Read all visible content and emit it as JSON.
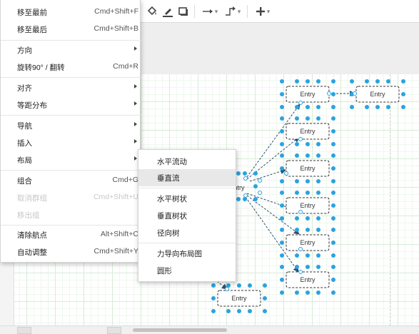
{
  "context_menu": {
    "items": [
      {
        "label": "移至最前",
        "shortcut": "Cmd+Shift+F"
      },
      {
        "label": "移至最后",
        "shortcut": "Cmd+Shift+B"
      },
      {
        "label": "方向",
        "submenu": true
      },
      {
        "label": "旋转90° / 翻转",
        "shortcut": "Cmd+R"
      },
      {
        "label": "对齐",
        "submenu": true
      },
      {
        "label": "等距分布",
        "submenu": true
      },
      {
        "label": "导航",
        "submenu": true
      },
      {
        "label": "插入",
        "submenu": true
      },
      {
        "label": "布局",
        "submenu": true
      },
      {
        "label": "组合",
        "shortcut": "Cmd+G"
      },
      {
        "label": "取消群组",
        "shortcut": "Cmd+Shift+U",
        "disabled": true
      },
      {
        "label": "移出组",
        "disabled": true
      },
      {
        "label": "清除航点",
        "shortcut": "Alt+Shift+C"
      },
      {
        "label": "自动调整",
        "shortcut": "Cmd+Shift+Y"
      }
    ]
  },
  "layout_submenu": {
    "items": [
      {
        "label": "水平流动"
      },
      {
        "label": "垂直流",
        "highlighted": true
      },
      {
        "label": "水平树状"
      },
      {
        "label": "垂直树状"
      },
      {
        "label": "径向树"
      },
      {
        "label": "力导向布局图"
      },
      {
        "label": "圆形"
      }
    ]
  },
  "toolbar": {
    "icons": [
      "fill-color-icon",
      "line-color-icon",
      "shadow-icon",
      "connection-style-icon",
      "waypoints-icon",
      "insert-icon"
    ],
    "dropdown_glyph": "▾"
  },
  "diagram": {
    "nodes": [
      {
        "id": "n1",
        "label": "Entry"
      },
      {
        "id": "n2",
        "label": "Entry"
      },
      {
        "id": "n3",
        "label": "Entry"
      },
      {
        "id": "n4",
        "label": "Entry"
      },
      {
        "id": "n5",
        "label": "Entry"
      },
      {
        "id": "n6",
        "label": "Entry"
      },
      {
        "id": "n7",
        "label": "Entry"
      },
      {
        "id": "hub",
        "label": "ntry"
      },
      {
        "id": "bottom",
        "label": "Entry"
      }
    ],
    "colors": {
      "selection": "#29a3e0",
      "node_border": "#333333",
      "edge": "#2f4f6f",
      "grid": "#d7ecd7"
    }
  }
}
